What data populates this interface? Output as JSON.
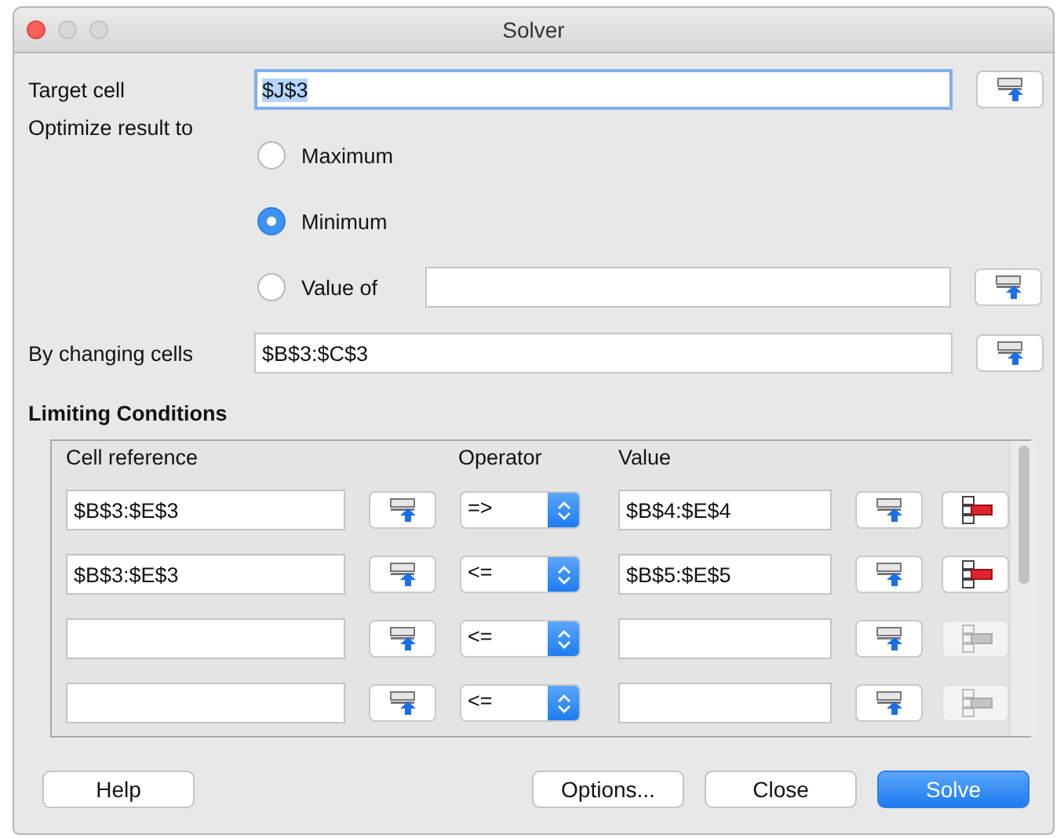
{
  "window": {
    "title": "Solver"
  },
  "target_cell": {
    "label": "Target cell",
    "value": "$J$3",
    "focused": true
  },
  "optimize": {
    "label": "Optimize result to",
    "options": [
      {
        "label": "Maximum",
        "selected": false,
        "kind": "plain"
      },
      {
        "label": "Minimum",
        "selected": true,
        "kind": "plain"
      },
      {
        "label": "Value of",
        "selected": false,
        "kind": "field"
      }
    ]
  },
  "changing_cells": {
    "label": "By changing cells",
    "value": "$B$3:$C$3"
  },
  "limiting_conditions": {
    "title": "Limiting Conditions",
    "columns": [
      "Cell reference",
      "Operator",
      "Value"
    ],
    "rows": [
      {
        "cell_reference": "$B$3:$E$3",
        "operator": "=>",
        "value": "$B$4:$E$4",
        "remove_enabled": true
      },
      {
        "cell_reference": "$B$3:$E$3",
        "operator": "<=",
        "value": "$B$5:$E$5",
        "remove_enabled": true
      },
      {
        "operator": "<=",
        "remove_enabled": false
      },
      {
        "operator": "<=",
        "remove_enabled": false
      }
    ]
  },
  "buttons": [
    {
      "label": "Help",
      "kind": "left"
    },
    {
      "label": "Options...",
      "kind": "right"
    },
    {
      "label": "Close",
      "kind": "right"
    },
    {
      "label": "Solve",
      "kind": "default"
    }
  ]
}
